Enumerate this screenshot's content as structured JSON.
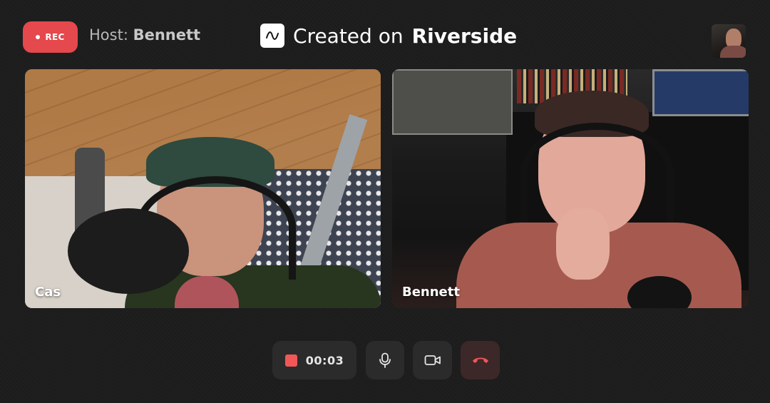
{
  "header": {
    "rec_label": "REC",
    "host_prefix": "Host:",
    "host_name": "Bennett",
    "brand_prefix": "Created on",
    "brand_name": "Riverside"
  },
  "participants": [
    {
      "name": "Cas"
    },
    {
      "name": "Bennett"
    }
  ],
  "controls": {
    "timer": "00:03",
    "icons": [
      "record-stop-icon",
      "microphone-icon",
      "camera-icon",
      "end-call-icon"
    ]
  },
  "colors": {
    "rec": "#e5484d",
    "background": "#1e1e1e",
    "control_bg": "#2b2b2b",
    "end_call": "#f25757"
  }
}
